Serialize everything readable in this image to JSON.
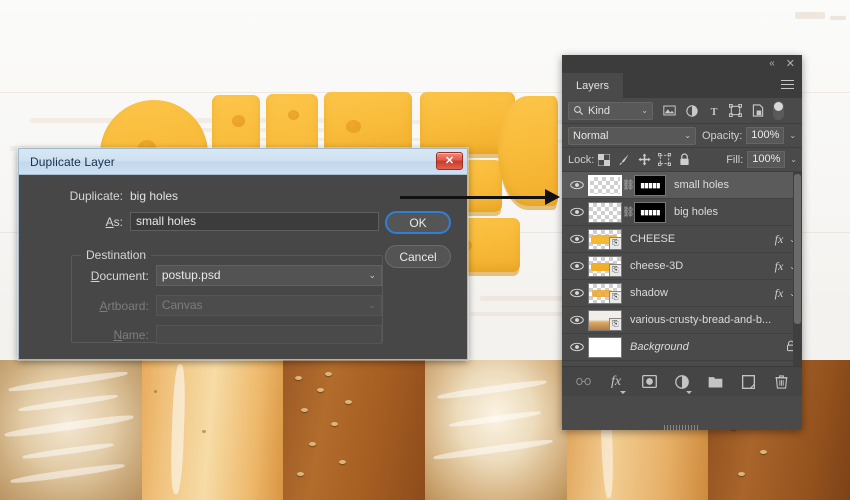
{
  "dialog": {
    "title": "Duplicate Layer",
    "close_label": "✕",
    "duplicate_label": "Duplicate:",
    "duplicate_value": "big holes",
    "as_label_prefix": "A",
    "as_label_suffix": "s:",
    "as_value": "small holes",
    "destination_group": "Destination",
    "document_label_prefix": "D",
    "document_label_suffix": "ocument:",
    "document_value": "postup.psd",
    "artboard_label_prefix": "A",
    "artboard_label_suffix": "rtboard:",
    "artboard_value": "Canvas",
    "name_label_prefix": "N",
    "name_label_suffix": "ame:",
    "name_value": "",
    "ok_label": "OK",
    "cancel_label": "Cancel"
  },
  "panel": {
    "collapse_icon": "«",
    "close_icon": "✕",
    "tab_label": "Layers",
    "filter": {
      "search_icon": "search-icon",
      "kind_label": "Kind",
      "chevron": "⌄",
      "icons": [
        "image-filter-icon",
        "adjustment-filter-icon",
        "type-filter-icon",
        "shape-filter-icon",
        "smartobject-filter-icon"
      ],
      "toggle": "filter-toggle"
    },
    "blend": {
      "mode": "Normal",
      "chevron": "⌄",
      "opacity_label": "Opacity:",
      "opacity_value": "100%"
    },
    "lock": {
      "lock_label": "Lock:",
      "icons": [
        "transparency-lock-icon",
        "image-lock-icon",
        "position-lock-icon",
        "artboard-lock-icon",
        "all-lock-icon"
      ],
      "fill_label": "Fill:",
      "fill_value": "100%"
    },
    "layers": [
      {
        "name": "small holes",
        "visible": true,
        "selected": true,
        "thumb_type": "transparent",
        "has_mask": true,
        "mask_text": "small holes",
        "linked": true,
        "has_fx": false,
        "locked": false,
        "smart_object": false,
        "italic": false
      },
      {
        "name": "big holes",
        "visible": true,
        "selected": false,
        "thumb_type": "transparent",
        "has_mask": true,
        "mask_text": "big holes",
        "linked": true,
        "has_fx": false,
        "locked": false,
        "smart_object": false,
        "italic": false
      },
      {
        "name": "CHEESE",
        "visible": true,
        "selected": false,
        "thumb_type": "cheese",
        "has_mask": false,
        "linked": false,
        "has_fx": true,
        "fx_label": "fx",
        "locked": false,
        "smart_object": true,
        "italic": false
      },
      {
        "name": "cheese-3D",
        "visible": true,
        "selected": false,
        "thumb_type": "cheese",
        "has_mask": false,
        "linked": false,
        "has_fx": true,
        "fx_label": "fx",
        "locked": false,
        "smart_object": true,
        "italic": false
      },
      {
        "name": "shadow",
        "visible": true,
        "selected": false,
        "thumb_type": "cheese",
        "has_mask": false,
        "linked": false,
        "has_fx": true,
        "fx_label": "fx",
        "locked": false,
        "smart_object": true,
        "italic": false
      },
      {
        "name": "various-crusty-bread-and-b...",
        "visible": true,
        "selected": false,
        "thumb_type": "bread",
        "has_mask": false,
        "linked": false,
        "has_fx": false,
        "locked": false,
        "smart_object": true,
        "italic": false
      },
      {
        "name": "Background",
        "visible": true,
        "selected": false,
        "thumb_type": "white",
        "has_mask": false,
        "linked": false,
        "has_fx": false,
        "locked": true,
        "lock_label": "🔒",
        "smart_object": false,
        "italic": true
      }
    ],
    "footer_icons": [
      "link-layers-icon",
      "add-layer-style-icon",
      "add-layer-mask-icon",
      "new-adjustment-layer-icon",
      "new-group-icon",
      "new-layer-icon",
      "delete-layer-icon"
    ],
    "footer_labels": {
      "fx": "fx"
    }
  },
  "canvas": {
    "description": "cheese-letters-on-white-wood-with-bread-photo"
  },
  "annotation": {
    "arrow": "arrow-from-ok-button-to-small-holes-layer"
  }
}
